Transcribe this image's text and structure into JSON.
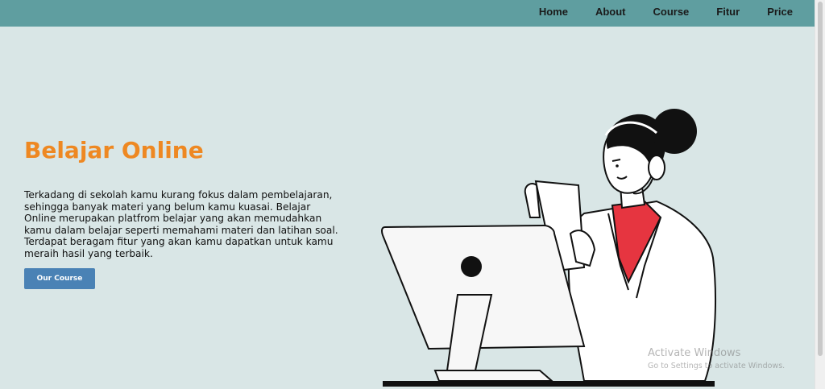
{
  "nav": {
    "items": [
      "Home",
      "About",
      "Course",
      "Fitur",
      "Price"
    ]
  },
  "hero": {
    "title": "Belajar Online",
    "description": "Terkadang di sekolah kamu kurang fokus dalam pembelajaran, sehingga banyak materi yang belum kamu kuasai. Belajar Online merupakan platfrom belajar yang akan memudahkan kamu dalam belajar seperti memahami materi dan latihan soal. Terdapat beragam fitur yang akan kamu dapatkan untuk kamu meraih hasil yang terbaik.",
    "button_label": "Our Course"
  },
  "watermark": {
    "title": "Activate Windows",
    "subtitle": "Go to Settings to activate Windows."
  },
  "colors": {
    "navbar": "#5f9ea0",
    "background": "#d9e6e6",
    "title": "#ee8822",
    "button": "#4a82b5",
    "shirt": "#e63540"
  },
  "icons": [
    "person-with-headset-illustration",
    "monitor-illustration"
  ]
}
